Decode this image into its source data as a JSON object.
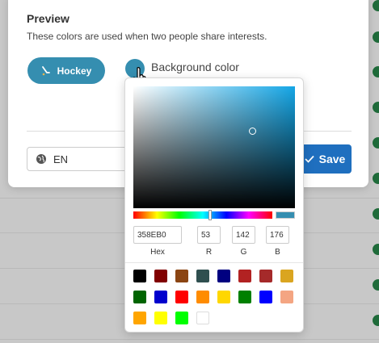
{
  "modal": {
    "title": "Preview",
    "subtitle": "These colors are used when two people share interests.",
    "chip_label": "Hockey",
    "background_label": "Background color",
    "language": "EN",
    "save_label": "Save"
  },
  "picker": {
    "hex_value": "358EB0",
    "r_value": "53",
    "g_value": "142",
    "b_value": "176",
    "hex_label": "Hex",
    "r_label": "R",
    "g_label": "G",
    "b_label": "B",
    "presets": [
      "#000000",
      "#800000",
      "#8b4513",
      "#2f4f4f",
      "#000080",
      "#b22222",
      "#a52a2a",
      "#daa520",
      "#006400",
      "#0000cd",
      "#ff0000",
      "#ff8c00",
      "#ffd700",
      "#008000",
      "#0000ff",
      "#f4a582",
      "#ffa500",
      "#ffff00",
      "#00ff00",
      "#ffffff"
    ]
  },
  "colors": {
    "accent": "#358EB0",
    "save": "#1F6FBF"
  }
}
